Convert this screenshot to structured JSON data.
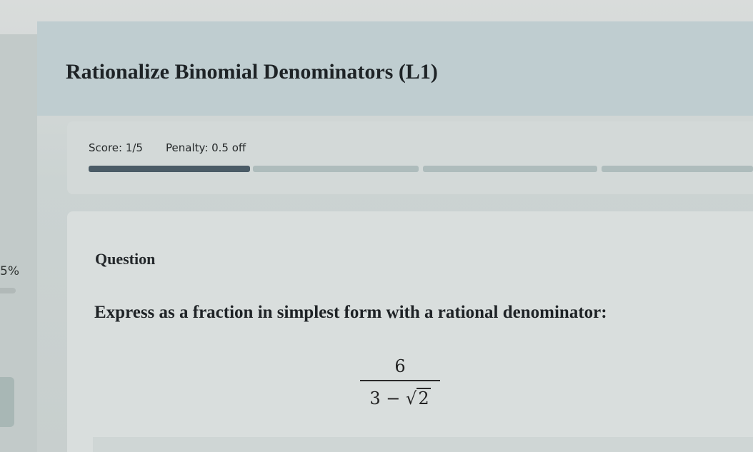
{
  "header": {
    "title": "Rationalize Binomial Denominators (L1)"
  },
  "sidebar": {
    "percent": "5%"
  },
  "score_card": {
    "score": "Score: 1/5",
    "penalty": "Penalty: 0.5 off",
    "progress": {
      "segments": 4,
      "completed": 1
    },
    "colors": {
      "filled": "#4a5b66",
      "empty": "#aebcbc"
    }
  },
  "question": {
    "label": "Question",
    "prompt": "Express as a fraction in simplest form with a rational denominator:",
    "fraction": {
      "numerator": "6",
      "denominator_prefix": "3 − ",
      "radical_sign": "√",
      "radicand": "2"
    }
  }
}
